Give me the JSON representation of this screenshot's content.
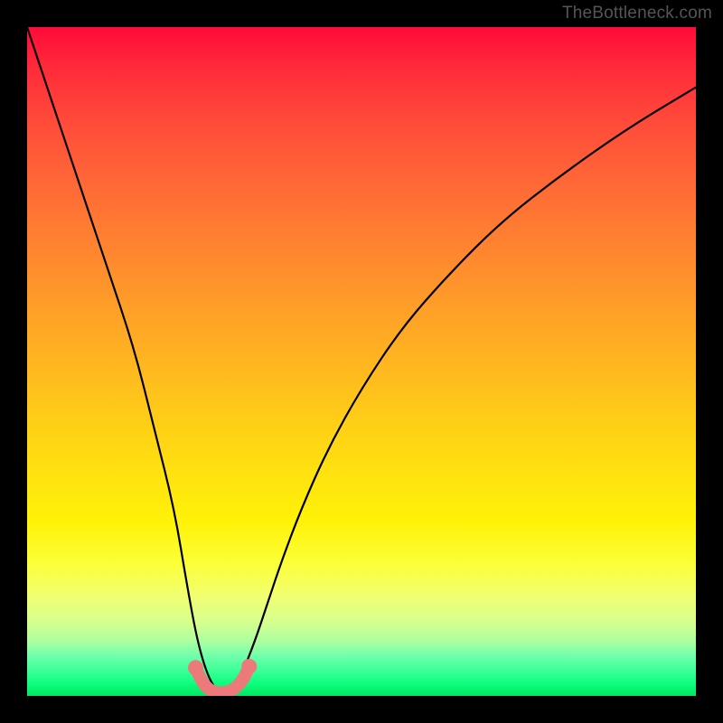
{
  "watermark": "TheBottleneck.com",
  "chart_data": {
    "type": "line",
    "title": "",
    "xlabel": "",
    "ylabel": "",
    "xlim": [
      0,
      100
    ],
    "ylim": [
      0,
      100
    ],
    "grid": false,
    "legend": false,
    "series": [
      {
        "name": "bottleneck-curve",
        "color": "#000000",
        "x": [
          0,
          4,
          8,
          12,
          16,
          19,
          22,
          24,
          25.5,
          27,
          28.5,
          30,
          32,
          34,
          36,
          38,
          41,
          45,
          50,
          56,
          63,
          71,
          80,
          90,
          100
        ],
        "y": [
          100,
          88,
          76,
          64,
          52,
          40,
          28,
          16,
          8,
          3,
          0.5,
          0.5,
          3,
          8,
          14,
          20,
          28,
          37,
          46,
          55,
          63,
          71,
          78,
          85,
          91
        ]
      },
      {
        "name": "highlight-marker-arc",
        "color": "#ec7a7a",
        "x": [
          25.2,
          25.9,
          26.7,
          27.6,
          28.6,
          29.6,
          30.6,
          31.6,
          32.5,
          33.2
        ],
        "y": [
          4.2,
          2.6,
          1.4,
          0.7,
          0.5,
          0.5,
          0.8,
          1.6,
          2.8,
          4.4
        ]
      }
    ],
    "background_gradient": {
      "stops": [
        {
          "pos": 0.0,
          "color": "#ff0a3a"
        },
        {
          "pos": 0.25,
          "color": "#ff6a36"
        },
        {
          "pos": 0.5,
          "color": "#ffc61a"
        },
        {
          "pos": 0.75,
          "color": "#fff208"
        },
        {
          "pos": 0.9,
          "color": "#d6ff8e"
        },
        {
          "pos": 1.0,
          "color": "#00e860"
        }
      ]
    }
  }
}
